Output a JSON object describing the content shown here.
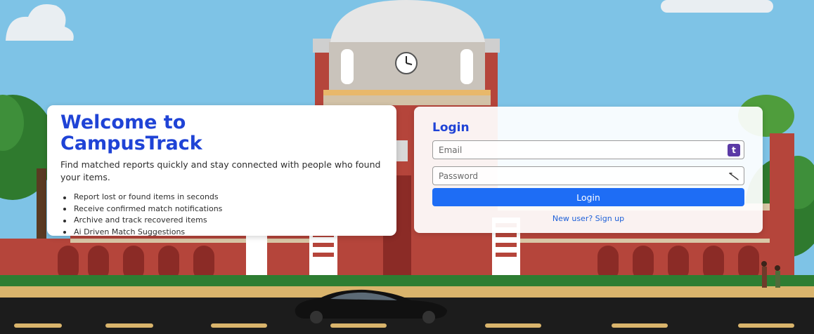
{
  "welcome": {
    "title_line1": "Welcome to",
    "title_line2": "CampusTrack",
    "description": "Find matched reports quickly and stay connected with people who found your items.",
    "features": [
      "Report lost or found items in seconds",
      "Receive confirmed match notifications",
      "Archive and track recovered items",
      "Ai Driven Match Suggestions"
    ]
  },
  "login": {
    "title": "Login",
    "email_placeholder": "Email",
    "password_placeholder": "Password",
    "extension_icon_letter": "t",
    "submit_label": "Login",
    "signup_link": "New user? Sign up"
  },
  "colors": {
    "accent": "#1f43d6",
    "button": "#1e6df5",
    "link": "#1e60d8",
    "sky": "#7ec3e6",
    "brick": "#b5453b"
  }
}
